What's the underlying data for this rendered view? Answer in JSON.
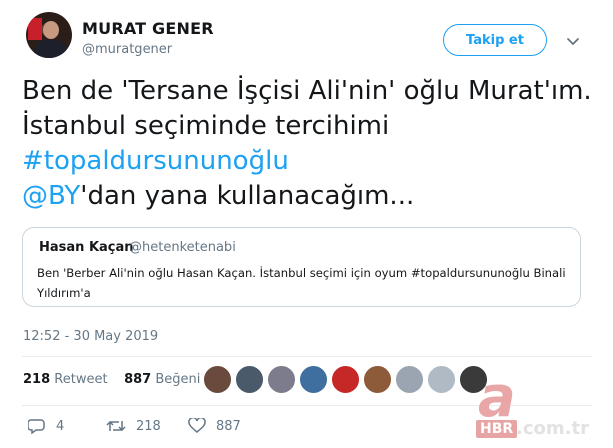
{
  "author": {
    "name": "MURAT GENER",
    "handle": "@muratgener"
  },
  "follow_label": "Takip et",
  "tweet": {
    "line1": "Ben de 'Tersane İşçisi Ali'nin' oğlu Murat'ım.",
    "line2": "İstanbul seçiminde tercihimi",
    "hashtag": "#topaldursununoğlu",
    "mention": "@BY",
    "line4_rest": "'dan yana kullanacağım..."
  },
  "quoted": {
    "name": "Hasan Kaçan",
    "handle": "@hetenketenabi",
    "text": "Ben 'Berber Ali'nin oğlu Hasan Kaçan. İstanbul seçimi için oyum #topaldursununoğlu Binali Yıldırım'a"
  },
  "timestamp": "12:52 - 30 May 2019",
  "stats": {
    "retweets_count": "218",
    "retweets_label": "Retweet",
    "likes_count": "887",
    "likes_label": "Beğeni"
  },
  "likers": [
    {
      "color": "#6b4a3e"
    },
    {
      "color": "#4a5a6a"
    },
    {
      "color": "#7c7c8c"
    },
    {
      "color": "#3f6f9f"
    },
    {
      "color": "#c62828"
    },
    {
      "color": "#8d5a3a"
    },
    {
      "color": "#9aa5b1"
    },
    {
      "color": "#b0bac4"
    },
    {
      "color": "#3a3a3a"
    }
  ],
  "actions": {
    "reply_count": "4",
    "retweet_count": "218",
    "like_count": "887"
  },
  "watermark": {
    "letter": "a",
    "brand": "HBR",
    "domain": ".com.tr"
  },
  "colors": {
    "link": "#1da1f2",
    "secondary_text": "#657786",
    "border": "#ccd6dd"
  }
}
